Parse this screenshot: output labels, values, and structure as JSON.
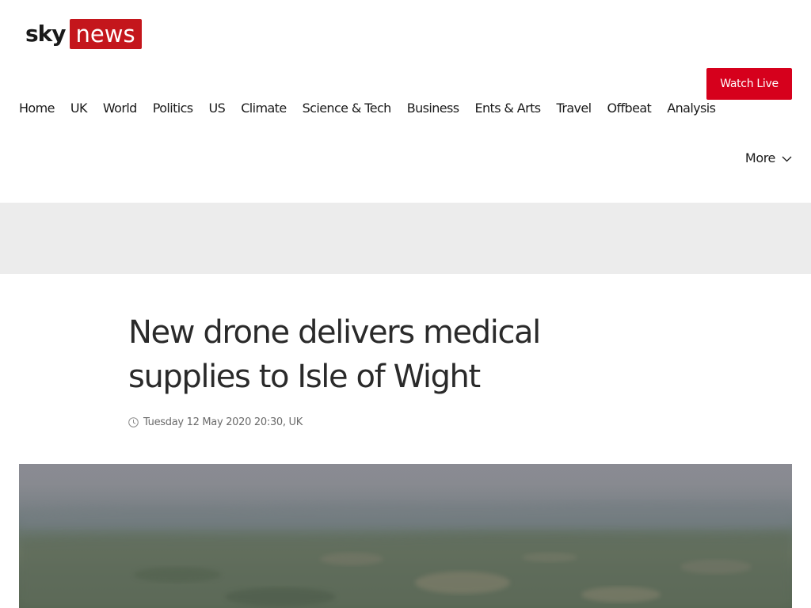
{
  "header": {
    "logo": {
      "sky": "sky",
      "news": "news"
    },
    "watch_live_label": "Watch Live",
    "more_label": "More"
  },
  "nav": {
    "items": [
      {
        "label": "Home"
      },
      {
        "label": "UK"
      },
      {
        "label": "World"
      },
      {
        "label": "Politics"
      },
      {
        "label": "US"
      },
      {
        "label": "Climate"
      },
      {
        "label": "Science & Tech"
      },
      {
        "label": "Business"
      },
      {
        "label": "Ents & Arts"
      },
      {
        "label": "Travel"
      },
      {
        "label": "Offbeat"
      },
      {
        "label": "Analysis"
      }
    ]
  },
  "article": {
    "title": "New drone delivers medical supplies to Isle of Wight",
    "timestamp": "Tuesday 12 May 2020 20:30, UK"
  },
  "icons": {
    "clock": "clock-icon",
    "more": "chevron-down-icon"
  },
  "colors": {
    "brand_red": "#c4161c",
    "watch_live_red": "#d6001c",
    "ad_band": "#ececec"
  }
}
